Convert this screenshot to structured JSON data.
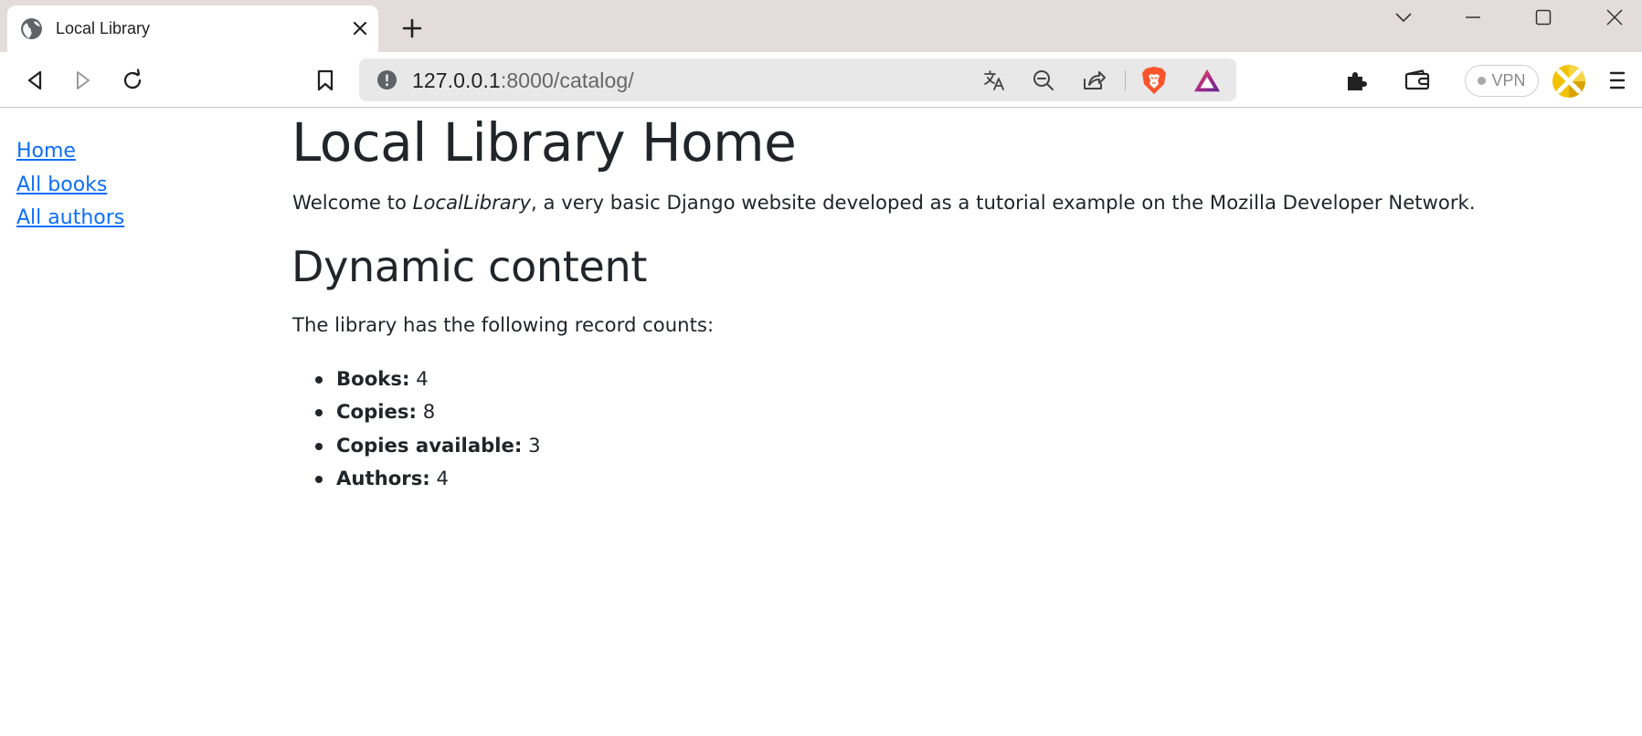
{
  "browser": {
    "tab": {
      "title": "Local Library",
      "favicon": "globe-icon"
    },
    "new_tab_icon": "plus-icon",
    "window_controls": [
      "chevron-down-icon",
      "minimize-icon",
      "maximize-icon",
      "close-icon"
    ],
    "nav": {
      "back_icon": "back-icon",
      "forward_icon": "forward-icon",
      "reload_icon": "reload-icon",
      "bookmark_icon": "bookmark-icon"
    },
    "url": {
      "host": "127.0.0.1",
      "rest": ":8000/catalog/",
      "info_icon": "info-icon"
    },
    "url_actions": [
      "translate-icon",
      "zoom-out-icon",
      "share-icon",
      "brave-shields-icon",
      "brave-rewards-icon"
    ],
    "toolbar_actions": [
      "extensions-icon",
      "wallet-icon",
      "vpn-button",
      "profile-icon",
      "menu-icon"
    ],
    "vpn_label": "VPN",
    "colors": {
      "tabstrip_bg": "#e3dcdb",
      "urlbar_bg": "#e8e8e8",
      "link": "#0d6efd",
      "brave_orange": "#fb542b"
    }
  },
  "sidebar": {
    "links": [
      {
        "label": "Home"
      },
      {
        "label": "All books"
      },
      {
        "label": "All authors"
      }
    ]
  },
  "main": {
    "title": "Local Library Home",
    "intro": {
      "before": "Welcome to ",
      "emphasis": "LocalLibrary",
      "after": ", a very basic Django website developed as a tutorial example on the Mozilla Developer Network."
    },
    "section_title": "Dynamic content",
    "summary": "The library has the following record counts:",
    "counts": [
      {
        "label": "Books:",
        "value": "4"
      },
      {
        "label": "Copies:",
        "value": "8"
      },
      {
        "label": "Copies available:",
        "value": "3"
      },
      {
        "label": "Authors:",
        "value": "4"
      }
    ]
  }
}
